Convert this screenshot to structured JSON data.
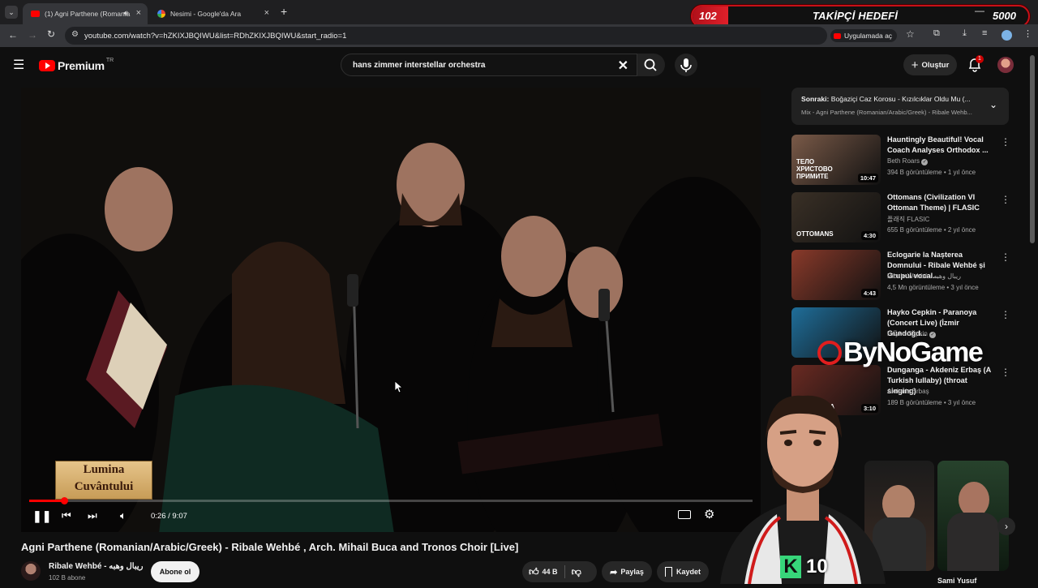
{
  "browser": {
    "tabs": [
      {
        "label": "(1) Agni Parthene (Romania",
        "active": true
      },
      {
        "label": "Nesimi - Google'da Ara",
        "active": false
      }
    ],
    "url": "youtube.com/watch?v=hZKIXJBQIWU&list=RDhZKIXJBQIWU&start_radio=1",
    "open_in_app_label": "Uygulamada aç"
  },
  "overlay": {
    "follower_current": "102",
    "follower_goal_label": "TAKİPÇİ HEDEFİ",
    "follower_target": "5000",
    "brand_watermark": "ByNoGame",
    "badge_text": "10"
  },
  "youtube": {
    "logo_label": "Premium",
    "logo_region": "TR",
    "search_value": "hans zimmer interstellar orchestra",
    "create_label": "Oluştur",
    "notifications_count": "1",
    "video": {
      "title": "Agni Parthene (Romanian/Arabic/Greek) - Ribale Wehbé , Arch. Mihail Buca and Tronos Choir [Live]",
      "time": "0:26 / 9:07",
      "progress": 0.048,
      "caption_line1": "Lumina",
      "caption_line2": "Cuvântului"
    },
    "channel": {
      "name": "Ribale Wehbé - ريبال وهبه",
      "subscribers": "102 B abone",
      "subscribe_label": "Abone ol"
    },
    "actions": {
      "like_count": "44 B",
      "share_label": "Paylaş",
      "save_label": "Kaydet"
    },
    "playlist": {
      "next_label": "Sonraki:",
      "next_title": "Boğaziçi Caz Korosu - Kızılcıklar Oldu Mu (...",
      "mix_label": "Mix - Agni Parthene (Romanian/Arabic/Greek) - Ribale Wehb..."
    },
    "recommendations": [
      {
        "title": "Hauntingly Beautiful! Vocal Coach Analyses Orthodox ...",
        "channel": "Beth Roars",
        "verified": true,
        "meta": "394 B görüntüleme • 1 yıl önce",
        "duration": "10:47",
        "thumb_text": "ТЕЛО ХРИСТОВО ПРИМИТЕ",
        "thumb_color": "#7a5a48"
      },
      {
        "title": "Ottomans (Civilization VI Ottoman Theme) | FLASIC",
        "channel": "플래직 FLASIC",
        "verified": false,
        "meta": "655 B görüntüleme • 2 yıl önce",
        "duration": "4:30",
        "thumb_text": "OTTOMANS",
        "thumb_color": "#3a3026"
      },
      {
        "title": "Eclogarie la Nașterea Domnului - Ribale Wehbé și Grupul vocal...",
        "channel": "Ribale Wehbé - ريبال وهبه",
        "verified": false,
        "meta": "4,5 Mn görüntüleme • 3 yıl önce",
        "duration": "4:43",
        "thumb_text": "",
        "thumb_color": "#8a3a2a"
      },
      {
        "title": "Hayko Cepkin - Paranoya (Concert Live) (İzmir Gündoğd...",
        "channel": "Hayko Cepkin",
        "verified": true,
        "meta": "",
        "duration": "",
        "thumb_text": "",
        "thumb_color": "#1f6e9a"
      },
      {
        "title": "Dunganga - Akdeniz Erbaş (A Turkish lullaby) (throat singing)",
        "channel": "Akdeniz Erbaş",
        "verified": false,
        "meta": "189 B görüntüleme • 3 yıl önce",
        "duration": "3:10",
        "thumb_text": "DUNGANGA",
        "thumb_color": "#6a2a22"
      }
    ],
    "shorts_label": "s",
    "shorts_caption": "Sami Yusuf"
  },
  "colors": {
    "yt_red": "#ff0000",
    "overlay_red": "#d0101a",
    "badge_green": "#37d67a"
  }
}
